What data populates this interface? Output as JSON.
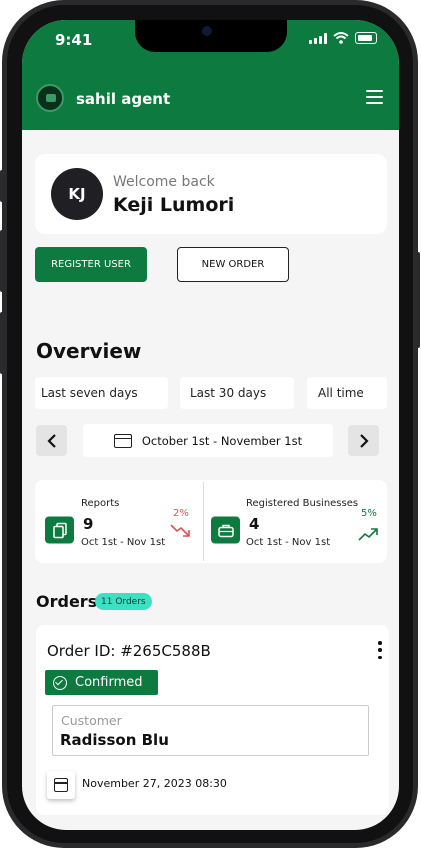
{
  "status": {
    "time": "9:41"
  },
  "header": {
    "brand": "sahil agent"
  },
  "profile": {
    "initials": "KJ",
    "welcome": "Welcome back",
    "name": "Keji Lumori"
  },
  "actions": {
    "register_label": "REGISTER USER",
    "new_order_label": "NEW ORDER"
  },
  "overview": {
    "title": "Overview",
    "filters": [
      "Last seven days",
      "Last 30 days",
      "All time"
    ],
    "date_range": "October 1st - November 1st"
  },
  "stats": [
    {
      "label": "Reports",
      "value": "9",
      "date": "Oct 1st - Nov 1st",
      "change": "2%",
      "trend": "down"
    },
    {
      "label": "Registered Businesses",
      "value": "4",
      "date": "Oct 1st - Nov 1st",
      "change": "5%",
      "trend": "up"
    }
  ],
  "orders": {
    "title": "Orders",
    "count_badge": "11 Orders",
    "items": [
      {
        "id": "Order ID: #265C588B",
        "status": "Confirmed",
        "customer_label": "Customer",
        "customer": "Radisson Blu",
        "date": "November 27, 2023 08:30"
      }
    ]
  },
  "colors": {
    "brand": "#0d7a3f",
    "badge": "#3ee0c3",
    "down": "#e05050",
    "up": "#0d7a3f"
  }
}
